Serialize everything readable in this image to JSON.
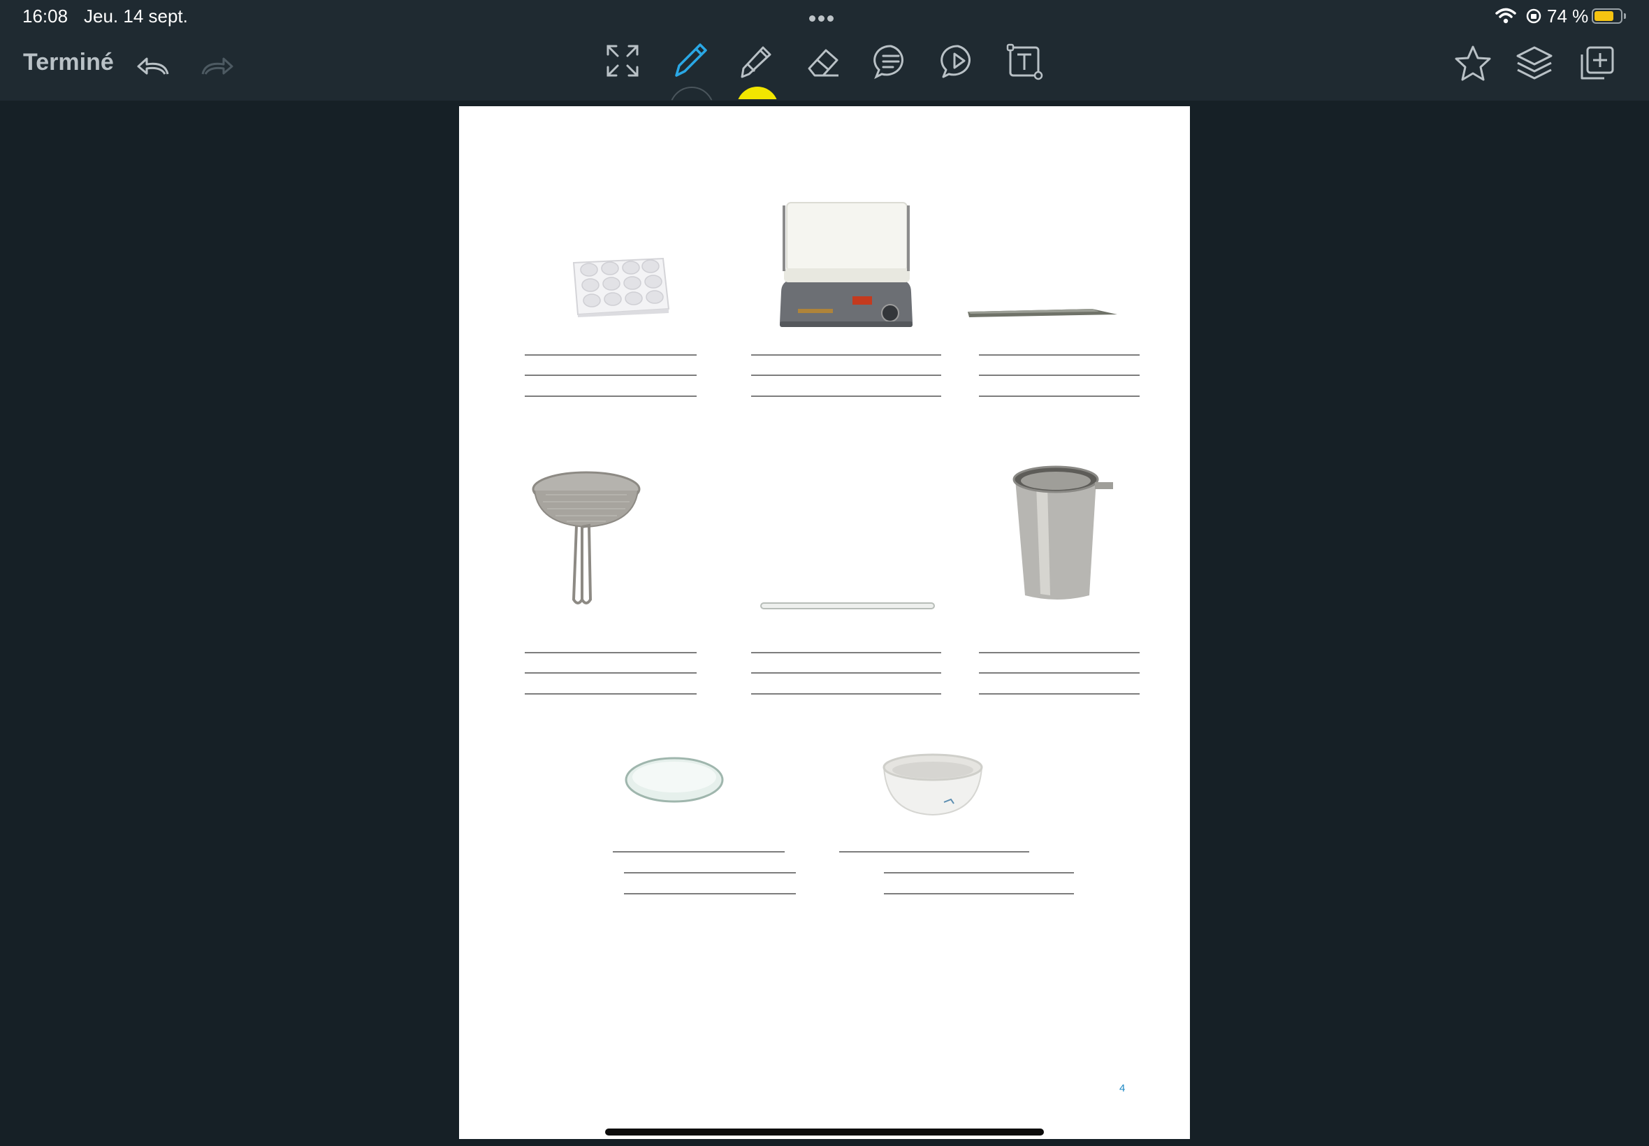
{
  "status_bar": {
    "time": "16:08",
    "date": "Jeu. 14 sept.",
    "battery_percent": "74 %",
    "battery_level": 0.74
  },
  "toolbar": {
    "done_label": "Terminé",
    "tools": [
      "fullscreen-icon",
      "pen-icon",
      "highlighter-icon",
      "eraser-icon",
      "comment-icon",
      "play-icon",
      "text-box-icon"
    ],
    "right_tools": [
      "star-icon",
      "layers-icon",
      "add-page-icon"
    ],
    "active_tool": "pen-icon",
    "accent_color": "#2aa8e6",
    "pen_indicator_color": "#1f2a31",
    "highlighter_indicator_color": "#f2e600"
  },
  "page": {
    "number": "4"
  },
  "worksheet": {
    "items": [
      "spot-plate",
      "hot-plate",
      "metal-spatula",
      "sieve",
      "glass-rod",
      "metal-beaker",
      "watch-glass",
      "evaporating-dish"
    ],
    "answer_lines_per_item": 3
  }
}
